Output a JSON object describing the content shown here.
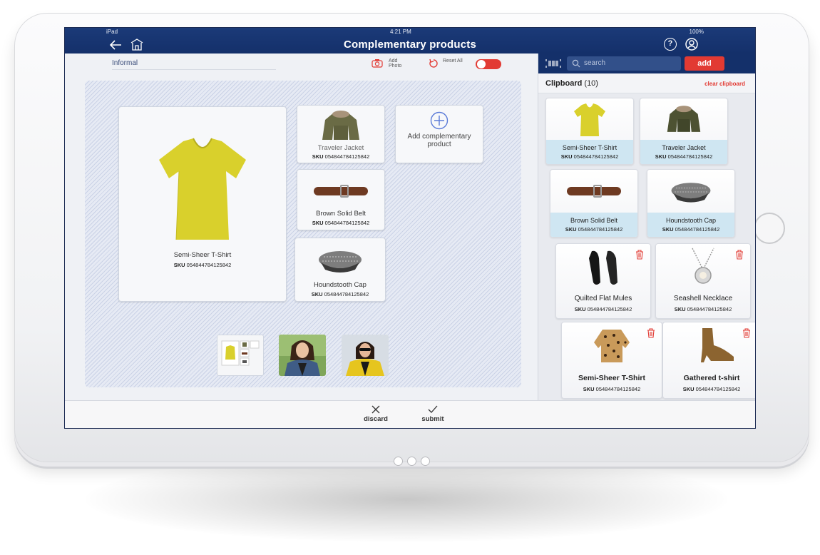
{
  "status": {
    "device": "iPad",
    "time": "4:21 PM",
    "battery": "100%"
  },
  "header": {
    "title": "Complementary products"
  },
  "look": {
    "name": "Informal",
    "tools": [
      {
        "label": "Add Photo",
        "icon": "camera-icon"
      },
      {
        "label": "Reset All",
        "icon": "reset-icon"
      }
    ]
  },
  "main_product": {
    "name": "Semi-Sheer T-Shirt",
    "sku_label": "SKU",
    "sku": "054844784125842"
  },
  "complementary": [
    {
      "name": "Traveler Jacket",
      "sku_label": "SKU",
      "sku": "054844784125842"
    },
    {
      "name": "Brown Solid Belt",
      "sku_label": "SKU",
      "sku": "054844784125842"
    },
    {
      "name": "Houndstooth Cap",
      "sku_label": "SKU",
      "sku": "054844784125842"
    }
  ],
  "add_complementary": {
    "label": "Add complementary product"
  },
  "search": {
    "placeholder": "search",
    "add_label": "add"
  },
  "clipboard": {
    "title": "Clipboard",
    "count": "(10)",
    "clear_label": "clear clipboard",
    "items": [
      {
        "name": "Semi-Sheer T-Shirt",
        "sku_label": "SKU",
        "sku": "054844784125842",
        "selected": true
      },
      {
        "name": "Traveler Jacket",
        "sku_label": "SKU",
        "sku": "054844784125842",
        "selected": true
      },
      {
        "name": "Brown Solid Belt",
        "sku_label": "SKU",
        "sku": "054844784125842",
        "selected": true
      },
      {
        "name": "Houndstooth Cap",
        "sku_label": "SKU",
        "sku": "054844784125842",
        "selected": true
      },
      {
        "name": "Quilted Flat Mules",
        "sku_label": "SKU",
        "sku": "054844784125842",
        "selected": false
      },
      {
        "name": "Seashell Necklace",
        "sku_label": "SKU",
        "sku": "054844784125842",
        "selected": false
      },
      {
        "name": "Semi-Sheer T-Shirt",
        "sku_label": "SKU",
        "sku": "054844784125842",
        "selected": false
      },
      {
        "name": "Gathered t-shirt",
        "sku_label": "SKU",
        "sku": "054844784125842",
        "selected": false
      }
    ]
  },
  "actions": {
    "discard": "discard",
    "submit": "submit"
  },
  "colors": {
    "navy": "#14306a",
    "accent_red": "#e23a33",
    "selected_tile": "#cfe6f2"
  }
}
